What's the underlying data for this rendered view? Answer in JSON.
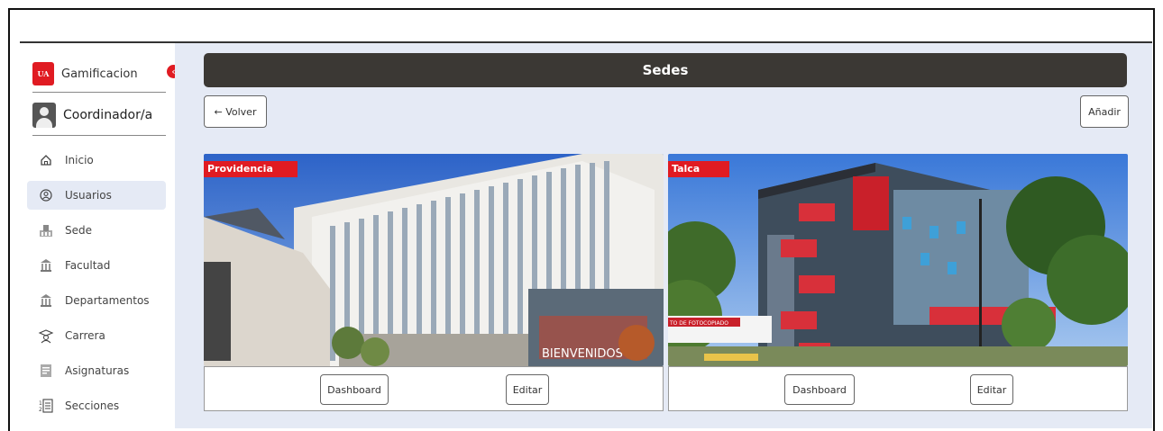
{
  "sidebar": {
    "brand": {
      "logo_text": "UA",
      "title": "Gamificacion"
    },
    "collapse_icon": "chevron-left-icon",
    "role": "Coordinador/a",
    "items": [
      {
        "label": "Inicio",
        "icon": "home-icon",
        "active": false
      },
      {
        "label": "Usuarios",
        "icon": "user-circle-icon",
        "active": true
      },
      {
        "label": "Sede",
        "icon": "building-icon",
        "active": false
      },
      {
        "label": "Facultad",
        "icon": "institution-icon",
        "active": false
      },
      {
        "label": "Departamentos",
        "icon": "institution-icon",
        "active": false
      },
      {
        "label": "Carrera",
        "icon": "graduate-icon",
        "active": false
      },
      {
        "label": "Asignaturas",
        "icon": "book-icon",
        "active": false
      },
      {
        "label": "Secciones",
        "icon": "numbered-list-icon",
        "active": false
      }
    ]
  },
  "header": {
    "title": "Sedes"
  },
  "toolbar": {
    "back_label": "← Volver",
    "add_label": "Añadir"
  },
  "cards": [
    {
      "tag": "Providencia",
      "dashboard_label": "Dashboard",
      "edit_label": "Editar",
      "photo_text": "BIENVENIDOS"
    },
    {
      "tag": "Talca",
      "dashboard_label": "Dashboard",
      "edit_label": "Editar",
      "photo_text": "TO DE FOTOCOPIADO"
    }
  ],
  "colors": {
    "accent": "#e01b22",
    "header_bg": "#3b3834",
    "main_bg": "#e5eaf5"
  }
}
